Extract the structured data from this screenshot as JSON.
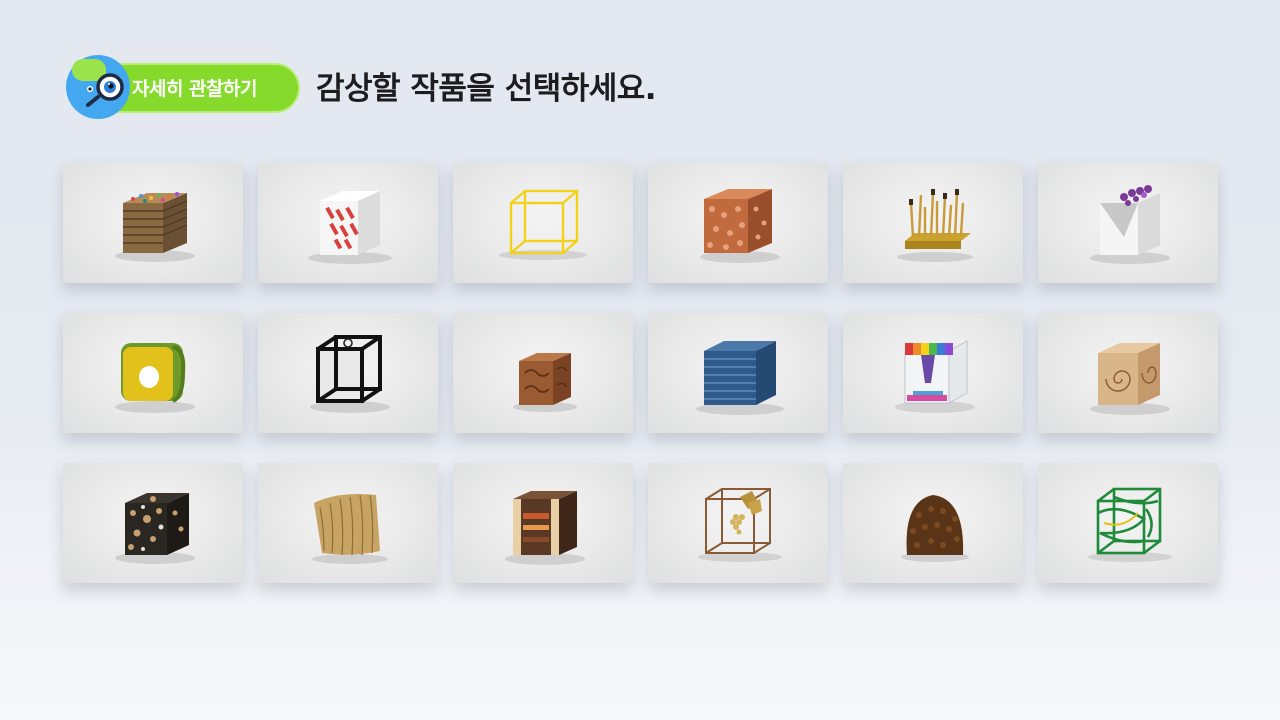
{
  "header": {
    "badge_label": "자세히 관찰하기",
    "title": "감상할 작품을 선택하세요.",
    "badge_icon": "magnifier-mascot-icon"
  },
  "colors": {
    "badge_green": "#86da2c",
    "badge_blue": "#44a8f0",
    "background": "#e3e7ef"
  },
  "artworks": [
    {
      "icon": "layered-cardboard-cube-icon"
    },
    {
      "icon": "white-cube-red-stripes-icon"
    },
    {
      "icon": "yellow-wire-cube-icon"
    },
    {
      "icon": "coral-sponge-cube-icon"
    },
    {
      "icon": "brushes-tray-icon"
    },
    {
      "icon": "white-cube-purple-gems-icon"
    },
    {
      "icon": "green-yellow-ring-cube-icon"
    },
    {
      "icon": "black-fur-frame-cube-icon"
    },
    {
      "icon": "carved-wood-cube-icon"
    },
    {
      "icon": "blue-fabric-stack-icon"
    },
    {
      "icon": "acrylic-rainbow-box-icon"
    },
    {
      "icon": "spiral-wood-cube-icon"
    },
    {
      "icon": "pebble-mosaic-cube-icon"
    },
    {
      "icon": "straw-paper-sculpture-icon"
    },
    {
      "icon": "wood-frame-block-icon"
    },
    {
      "icon": "wire-grapevine-icon"
    },
    {
      "icon": "pinecone-dome-icon"
    },
    {
      "icon": "green-yarn-cube-icon"
    }
  ]
}
